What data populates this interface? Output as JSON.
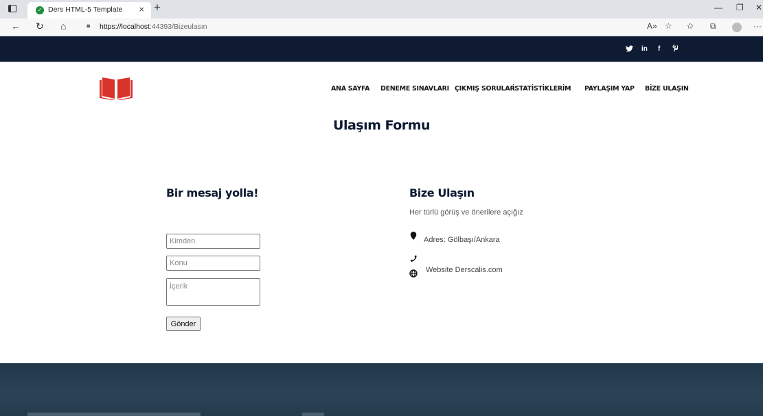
{
  "browser": {
    "tab_title": "Ders HTML-5 Template",
    "tab_close": "×",
    "new_tab": "+",
    "url_host": "https://localhost",
    "url_rest": ":44393/Bizeulasın",
    "back_glyph": "←",
    "reload_glyph": "↻",
    "home_glyph": "⌂",
    "lock_glyph": "🔒",
    "read_aloud": "A»",
    "favorites": "☆",
    "favorites_bar": "✩",
    "collections": "⧉",
    "more": "···",
    "minimize": "—",
    "restore": "❐"
  },
  "social": {
    "twitter": "🐦",
    "linkedin": "in",
    "facebook": "f",
    "pinterest": "P"
  },
  "nav": {
    "items": [
      {
        "label": "ANA SAYFA"
      },
      {
        "label": "DENEME SINAVLARI"
      },
      {
        "label": "ÇIKMIŞ SORULAR"
      },
      {
        "label": "İSTATİSTİKLERİM"
      },
      {
        "label": "PAYLAŞIM YAP"
      },
      {
        "label": "BİZE ULAŞIN"
      }
    ]
  },
  "page": {
    "title": "Ulaşım Formu"
  },
  "form": {
    "heading": "Bir mesaj yolla!",
    "from_placeholder": "Kimden",
    "subject_placeholder": "Konu",
    "content_placeholder": "İçerik",
    "submit_label": "Gönder"
  },
  "contact": {
    "heading": "Bize Ulaşın",
    "subtitle": "Her türlü görüş ve önerilere açığız",
    "address": "Adres: Gölbaşı/Ankara",
    "website": "Website Derscalis.com"
  },
  "colors": {
    "topbar": "#0f1a33",
    "logo": "#d9342b",
    "footer": "#21384a"
  }
}
